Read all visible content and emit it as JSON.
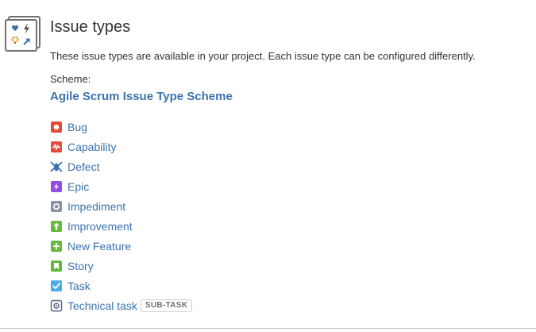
{
  "header": {
    "title": "Issue types",
    "icon": "issue-types-icon",
    "description": "These issue types are available in your project. Each issue type can be configured differently."
  },
  "scheme": {
    "label": "Scheme:",
    "name": "Agile Scrum Issue Type Scheme",
    "link_color": "#3b73af"
  },
  "issue_types": [
    {
      "name": "Bug",
      "icon": "bug-icon",
      "color": "#e5493a"
    },
    {
      "name": "Capability",
      "icon": "capability-icon",
      "color": "#e5493a"
    },
    {
      "name": "Defect",
      "icon": "defect-icon",
      "color": "#3b73af"
    },
    {
      "name": "Epic",
      "icon": "epic-icon",
      "color": "#904ee2"
    },
    {
      "name": "Impediment",
      "icon": "impediment-icon",
      "color": "#8993a4"
    },
    {
      "name": "Improvement",
      "icon": "improvement-icon",
      "color": "#63ba3c"
    },
    {
      "name": "New Feature",
      "icon": "new-feature-icon",
      "color": "#63ba3c"
    },
    {
      "name": "Story",
      "icon": "story-icon",
      "color": "#63ba3c"
    },
    {
      "name": "Task",
      "icon": "task-icon",
      "color": "#4bade8"
    },
    {
      "name": "Technical task",
      "icon": "technical-task-icon",
      "color": "#505f79",
      "badge": "SUB-TASK"
    }
  ]
}
